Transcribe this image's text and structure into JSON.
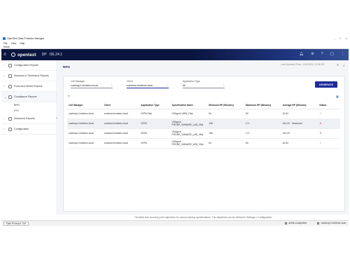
{
  "window": {
    "title": "OpenText Data Protector Manager",
    "controls": [
      "–",
      "□",
      "×"
    ]
  },
  "menubar": {
    "items": [
      "File",
      "View",
      "Help"
    ]
  },
  "viewbar": {
    "label": "Home"
  },
  "brand": {
    "logo": "opentext",
    "product": "DP",
    "version": "OE.24.1"
  },
  "sidebar": {
    "items": [
      {
        "label": "Configuration Reports"
      },
      {
        "label": "Sessions in Timeframe Reports"
      },
      {
        "label": "Pools And Media Reports"
      },
      {
        "label": "Compliance Reports"
      },
      {
        "label": "Advanced Reports"
      },
      {
        "label": "Configuration"
      }
    ],
    "compliance_sub": [
      "RPO",
      "RTO"
    ]
  },
  "main": {
    "title": "RPO",
    "last_updated": "Last Updated Time : 10/2/2024, 10:30:25",
    "filters": {
      "cell_manager": {
        "label": "Cell Manager",
        "value": "custmcp1.hmdemo.local"
      },
      "client": {
        "label": "Client",
        "value": "custmcw.hmdemo.local"
      },
      "application_type": {
        "label": "Application Type",
        "value": "All"
      }
    },
    "generate_label": "GENERATE",
    "table": {
      "headers": [
        "Cell Manager",
        "Client",
        "Application Type",
        "Specification Name",
        "Minimum RP (Minutes)",
        "Maximum RP (Minutes)",
        "Average RP (Minutes)",
        "Status"
      ],
      "rows": [
        {
          "cell_manager": "custmcp1.hmdemo.local",
          "client": "custmcw.hmdemo.local",
          "app_type": "VEPA Disk",
          "spec": "VEAgent VMW_Disk",
          "min": "54",
          "max": "83",
          "avg": "43.94",
          "breached": "",
          "status": "ok"
        },
        {
          "cell_manager": "custmcp1.hmdemo.local",
          "client": "custmcw.hmdemo.local",
          "app_type": "VEPA",
          "spec": "VEAgent PRODE_VMWARE_LAB_VMs",
          "min": "156",
          "max": "171",
          "avg": "164.29",
          "breached": "Breached",
          "status": "bad"
        },
        {
          "cell_manager": "custmcp1.hmdemo.local",
          "client": "custmcw.hmdemo.local",
          "app_type": "VEPA",
          "spec": "VEAgent PRODE_VMWARE_LAB_VMs",
          "min": "156",
          "max": "171",
          "avg": "164.29",
          "breached": "",
          "status": "bad"
        },
        {
          "cell_manager": "custmcp1.hmdemo.local",
          "client": "custmcw.hmdemo.local",
          "app_type": "VEPA",
          "spec": "VEAgent PRODE_VMWARE_WIN_VMs",
          "min": "54",
          "max": "83",
          "avg": "43.94",
          "breached": "",
          "status": "ok"
        }
      ]
    }
  },
  "status_message": "The table lists recovery point objectives for various backup specifications. The objectives can be defined in Settings > Configuration.",
  "bottombar": {
    "tab": "Data Protector Cell",
    "user": "admin.cudsyntest",
    "host": "custmcp1.hmdemo.local"
  },
  "icons": {
    "ok": "check-mark-icon",
    "bad": "cross-mark-icon",
    "filter": "filter-icon",
    "settings": "table-settings-icon"
  },
  "colors": {
    "brand_bar": "#0b1640",
    "accent": "#1d2b9a",
    "ok": "#2e9b4a",
    "bad": "#d13a3a"
  }
}
